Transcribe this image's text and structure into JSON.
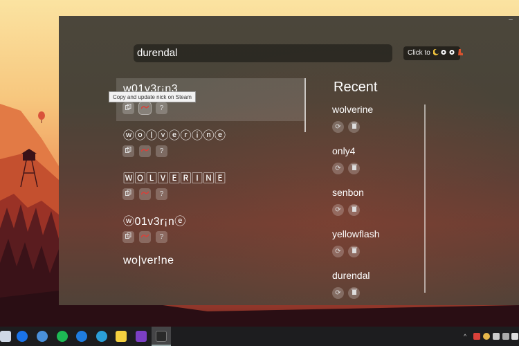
{
  "search": {
    "value": "durendal"
  },
  "click_to": {
    "label": "Click to"
  },
  "tooltip": "Copy and update nick on Steam",
  "results": [
    {
      "nick": "w01v3r¡n3",
      "selected": true
    },
    {
      "nick": "ⓦⓞⓛⓥⓔⓡⓘⓝⓔ",
      "selected": false
    },
    {
      "nick": "🅆🄾🄻🅅🄴🅁🄸🄽🄴",
      "selected": false
    },
    {
      "nick": "ⓦ01v3r¡nⓔ",
      "selected": false
    },
    {
      "nick": "wo|ver!ne",
      "selected": false
    }
  ],
  "result_button_icons": [
    "copy-icon",
    "steam-icon",
    "help-icon"
  ],
  "recent": {
    "title": "Recent",
    "items": [
      "wolverine",
      "only4",
      "senbon",
      "yellowflash",
      "durendal"
    ],
    "button_icons": [
      "restore-icon",
      "trash-icon"
    ]
  },
  "taskbar": {
    "icons": [
      "mail-icon",
      "firefox-icon",
      "chrome-icon",
      "spotify-icon",
      "edge-icon",
      "edge-beta-icon",
      "sticky-notes-icon",
      "visual-studio-icon",
      "terminal-icon"
    ],
    "tray_icons": [
      "chevron-up-icon",
      "steam-tray-icon",
      "cloud-icon",
      "volume-icon",
      "battery-icon",
      "network-icon"
    ]
  },
  "colors": {
    "accent_red": "#c4382e",
    "steam_icon": "#d9413a"
  }
}
